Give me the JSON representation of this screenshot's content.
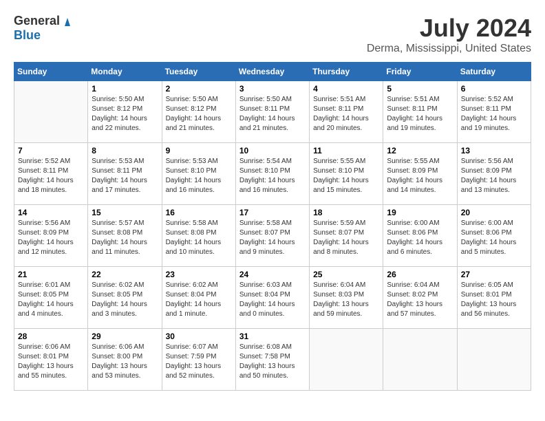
{
  "logo": {
    "general": "General",
    "blue": "Blue"
  },
  "title": {
    "month_year": "July 2024",
    "location": "Derma, Mississippi, United States"
  },
  "weekdays": [
    "Sunday",
    "Monday",
    "Tuesday",
    "Wednesday",
    "Thursday",
    "Friday",
    "Saturday"
  ],
  "weeks": [
    [
      {
        "day": "",
        "info": ""
      },
      {
        "day": "1",
        "info": "Sunrise: 5:50 AM\nSunset: 8:12 PM\nDaylight: 14 hours\nand 22 minutes."
      },
      {
        "day": "2",
        "info": "Sunrise: 5:50 AM\nSunset: 8:12 PM\nDaylight: 14 hours\nand 21 minutes."
      },
      {
        "day": "3",
        "info": "Sunrise: 5:50 AM\nSunset: 8:11 PM\nDaylight: 14 hours\nand 21 minutes."
      },
      {
        "day": "4",
        "info": "Sunrise: 5:51 AM\nSunset: 8:11 PM\nDaylight: 14 hours\nand 20 minutes."
      },
      {
        "day": "5",
        "info": "Sunrise: 5:51 AM\nSunset: 8:11 PM\nDaylight: 14 hours\nand 19 minutes."
      },
      {
        "day": "6",
        "info": "Sunrise: 5:52 AM\nSunset: 8:11 PM\nDaylight: 14 hours\nand 19 minutes."
      }
    ],
    [
      {
        "day": "7",
        "info": "Sunrise: 5:52 AM\nSunset: 8:11 PM\nDaylight: 14 hours\nand 18 minutes."
      },
      {
        "day": "8",
        "info": "Sunrise: 5:53 AM\nSunset: 8:11 PM\nDaylight: 14 hours\nand 17 minutes."
      },
      {
        "day": "9",
        "info": "Sunrise: 5:53 AM\nSunset: 8:10 PM\nDaylight: 14 hours\nand 16 minutes."
      },
      {
        "day": "10",
        "info": "Sunrise: 5:54 AM\nSunset: 8:10 PM\nDaylight: 14 hours\nand 16 minutes."
      },
      {
        "day": "11",
        "info": "Sunrise: 5:55 AM\nSunset: 8:10 PM\nDaylight: 14 hours\nand 15 minutes."
      },
      {
        "day": "12",
        "info": "Sunrise: 5:55 AM\nSunset: 8:09 PM\nDaylight: 14 hours\nand 14 minutes."
      },
      {
        "day": "13",
        "info": "Sunrise: 5:56 AM\nSunset: 8:09 PM\nDaylight: 14 hours\nand 13 minutes."
      }
    ],
    [
      {
        "day": "14",
        "info": "Sunrise: 5:56 AM\nSunset: 8:09 PM\nDaylight: 14 hours\nand 12 minutes."
      },
      {
        "day": "15",
        "info": "Sunrise: 5:57 AM\nSunset: 8:08 PM\nDaylight: 14 hours\nand 11 minutes."
      },
      {
        "day": "16",
        "info": "Sunrise: 5:58 AM\nSunset: 8:08 PM\nDaylight: 14 hours\nand 10 minutes."
      },
      {
        "day": "17",
        "info": "Sunrise: 5:58 AM\nSunset: 8:07 PM\nDaylight: 14 hours\nand 9 minutes."
      },
      {
        "day": "18",
        "info": "Sunrise: 5:59 AM\nSunset: 8:07 PM\nDaylight: 14 hours\nand 8 minutes."
      },
      {
        "day": "19",
        "info": "Sunrise: 6:00 AM\nSunset: 8:06 PM\nDaylight: 14 hours\nand 6 minutes."
      },
      {
        "day": "20",
        "info": "Sunrise: 6:00 AM\nSunset: 8:06 PM\nDaylight: 14 hours\nand 5 minutes."
      }
    ],
    [
      {
        "day": "21",
        "info": "Sunrise: 6:01 AM\nSunset: 8:05 PM\nDaylight: 14 hours\nand 4 minutes."
      },
      {
        "day": "22",
        "info": "Sunrise: 6:02 AM\nSunset: 8:05 PM\nDaylight: 14 hours\nand 3 minutes."
      },
      {
        "day": "23",
        "info": "Sunrise: 6:02 AM\nSunset: 8:04 PM\nDaylight: 14 hours\nand 1 minute."
      },
      {
        "day": "24",
        "info": "Sunrise: 6:03 AM\nSunset: 8:04 PM\nDaylight: 14 hours\nand 0 minutes."
      },
      {
        "day": "25",
        "info": "Sunrise: 6:04 AM\nSunset: 8:03 PM\nDaylight: 13 hours\nand 59 minutes."
      },
      {
        "day": "26",
        "info": "Sunrise: 6:04 AM\nSunset: 8:02 PM\nDaylight: 13 hours\nand 57 minutes."
      },
      {
        "day": "27",
        "info": "Sunrise: 6:05 AM\nSunset: 8:01 PM\nDaylight: 13 hours\nand 56 minutes."
      }
    ],
    [
      {
        "day": "28",
        "info": "Sunrise: 6:06 AM\nSunset: 8:01 PM\nDaylight: 13 hours\nand 55 minutes."
      },
      {
        "day": "29",
        "info": "Sunrise: 6:06 AM\nSunset: 8:00 PM\nDaylight: 13 hours\nand 53 minutes."
      },
      {
        "day": "30",
        "info": "Sunrise: 6:07 AM\nSunset: 7:59 PM\nDaylight: 13 hours\nand 52 minutes."
      },
      {
        "day": "31",
        "info": "Sunrise: 6:08 AM\nSunset: 7:58 PM\nDaylight: 13 hours\nand 50 minutes."
      },
      {
        "day": "",
        "info": ""
      },
      {
        "day": "",
        "info": ""
      },
      {
        "day": "",
        "info": ""
      }
    ]
  ]
}
